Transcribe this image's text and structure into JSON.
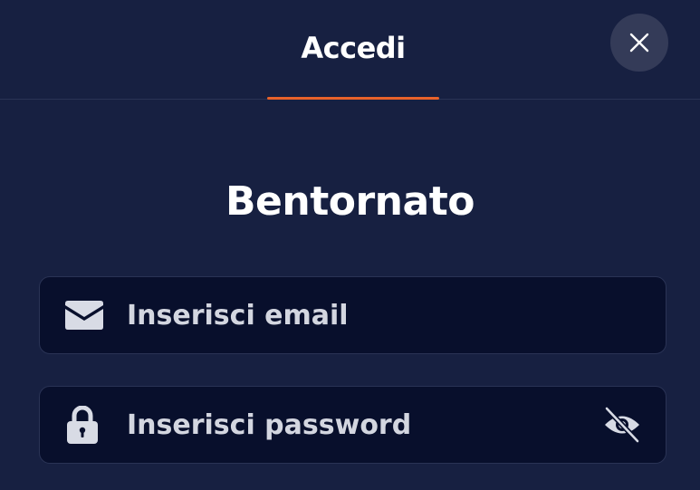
{
  "header": {
    "tab_label": "Accedi",
    "close_icon": "close-icon"
  },
  "main": {
    "title": "Bentornato",
    "email": {
      "placeholder": "Inserisci email",
      "value": "",
      "icon": "envelope-icon"
    },
    "password": {
      "placeholder": "Inserisci password",
      "value": "",
      "icon": "lock-icon",
      "toggle_icon": "eye-off-icon"
    }
  },
  "colors": {
    "background": "#172041",
    "field_background": "#080f2c",
    "accent": "#e8622a",
    "close_button": "#343b58"
  }
}
